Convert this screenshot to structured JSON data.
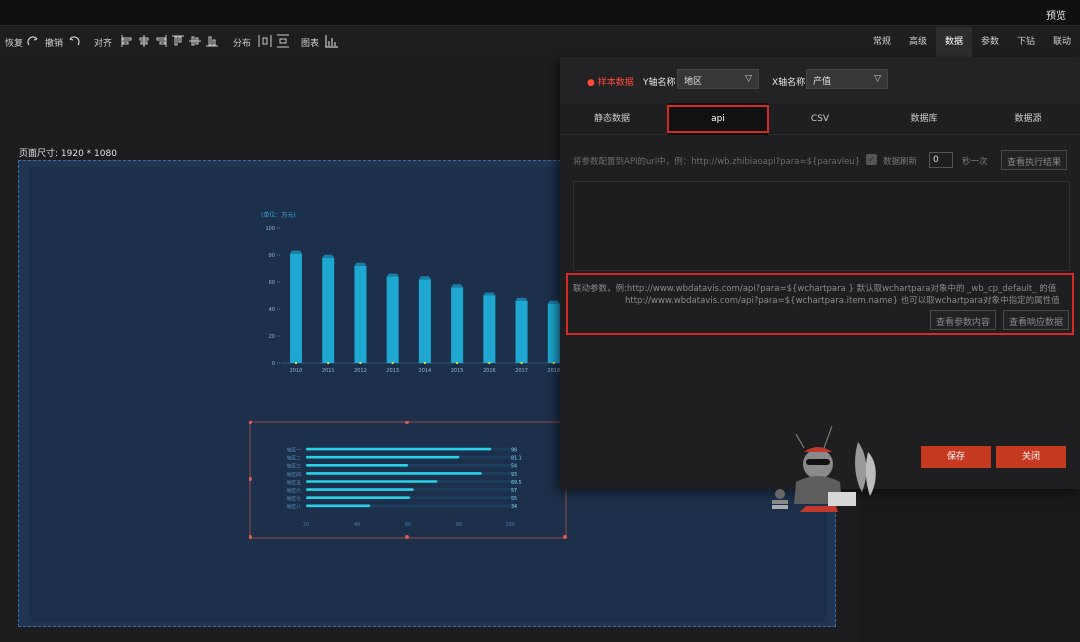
{
  "topbar": {
    "preview": "预览"
  },
  "toolbar": {
    "restore": "恢复",
    "undo": "撤销",
    "align": "对齐",
    "distribute": "分布",
    "chart": "图表"
  },
  "right_tabs": [
    "常规",
    "高级",
    "数据",
    "参数",
    "下钻",
    "联动"
  ],
  "active_right_tab": "数据",
  "canvas": {
    "page_size": "页面尺寸: 1920 * 1080"
  },
  "panel": {
    "sample_label": "● 样本数据",
    "y_axis_label": "Y轴名称",
    "y_axis_value": "地区",
    "x_axis_label": "X轴名称",
    "x_axis_value": "产值",
    "data_tabs": [
      "静态数据",
      "api",
      "CSV",
      "数据库",
      "数据源"
    ],
    "active_data_tab": "api",
    "api_hint": "将参数配置到API的url中，例：http://wb.zhibiaoapi?para=${paravleu}",
    "refresh_label": "数据刷新",
    "refresh_value": "0",
    "per_second": "秒一次",
    "view_exec_result": "查看执行结果",
    "link_param_line1": "联动参数，例:http://www.wbdatavis.com/api?para=${wchartpara } 默认取wchartpara对象中的 _wb_cp_default_ 的值",
    "link_param_line2": "http://www.wbdatavis.com/api?para=${wchartpara.item.name} 也可以取wchartpara对象中指定的属性值",
    "view_param_content": "查看参数内容",
    "view_response_data": "查看响应数据",
    "save": "保存",
    "close": "关闭"
  },
  "chart_data": [
    {
      "type": "bar",
      "ylabel": "(单位：万元)",
      "ylim": [
        0,
        100
      ],
      "yticks": [
        "0",
        "20",
        "40",
        "60",
        "80",
        "100"
      ],
      "categories": [
        "2010",
        "2011",
        "2012",
        "2013",
        "2014",
        "2015",
        "2016",
        "2017",
        "2018"
      ],
      "values": [
        81,
        78,
        72,
        64,
        62,
        56,
        50,
        46,
        44
      ],
      "colors": {
        "bar": "#1fb6e0",
        "bar_top": "#1a7ea8"
      }
    },
    {
      "type": "bar",
      "orientation": "horizontal",
      "categories": [
        "地区一",
        "地区二",
        "地区三",
        "地区四",
        "地区五",
        "地区六",
        "地区七",
        "地区八"
      ],
      "values": [
        98,
        81.1,
        54,
        93,
        69.5,
        57,
        55,
        34
      ],
      "xticks": [
        "20",
        "40",
        "60",
        "80",
        "100"
      ],
      "colors": {
        "bar": "#2ad1e8",
        "bg": "#1d3e5f"
      }
    }
  ]
}
